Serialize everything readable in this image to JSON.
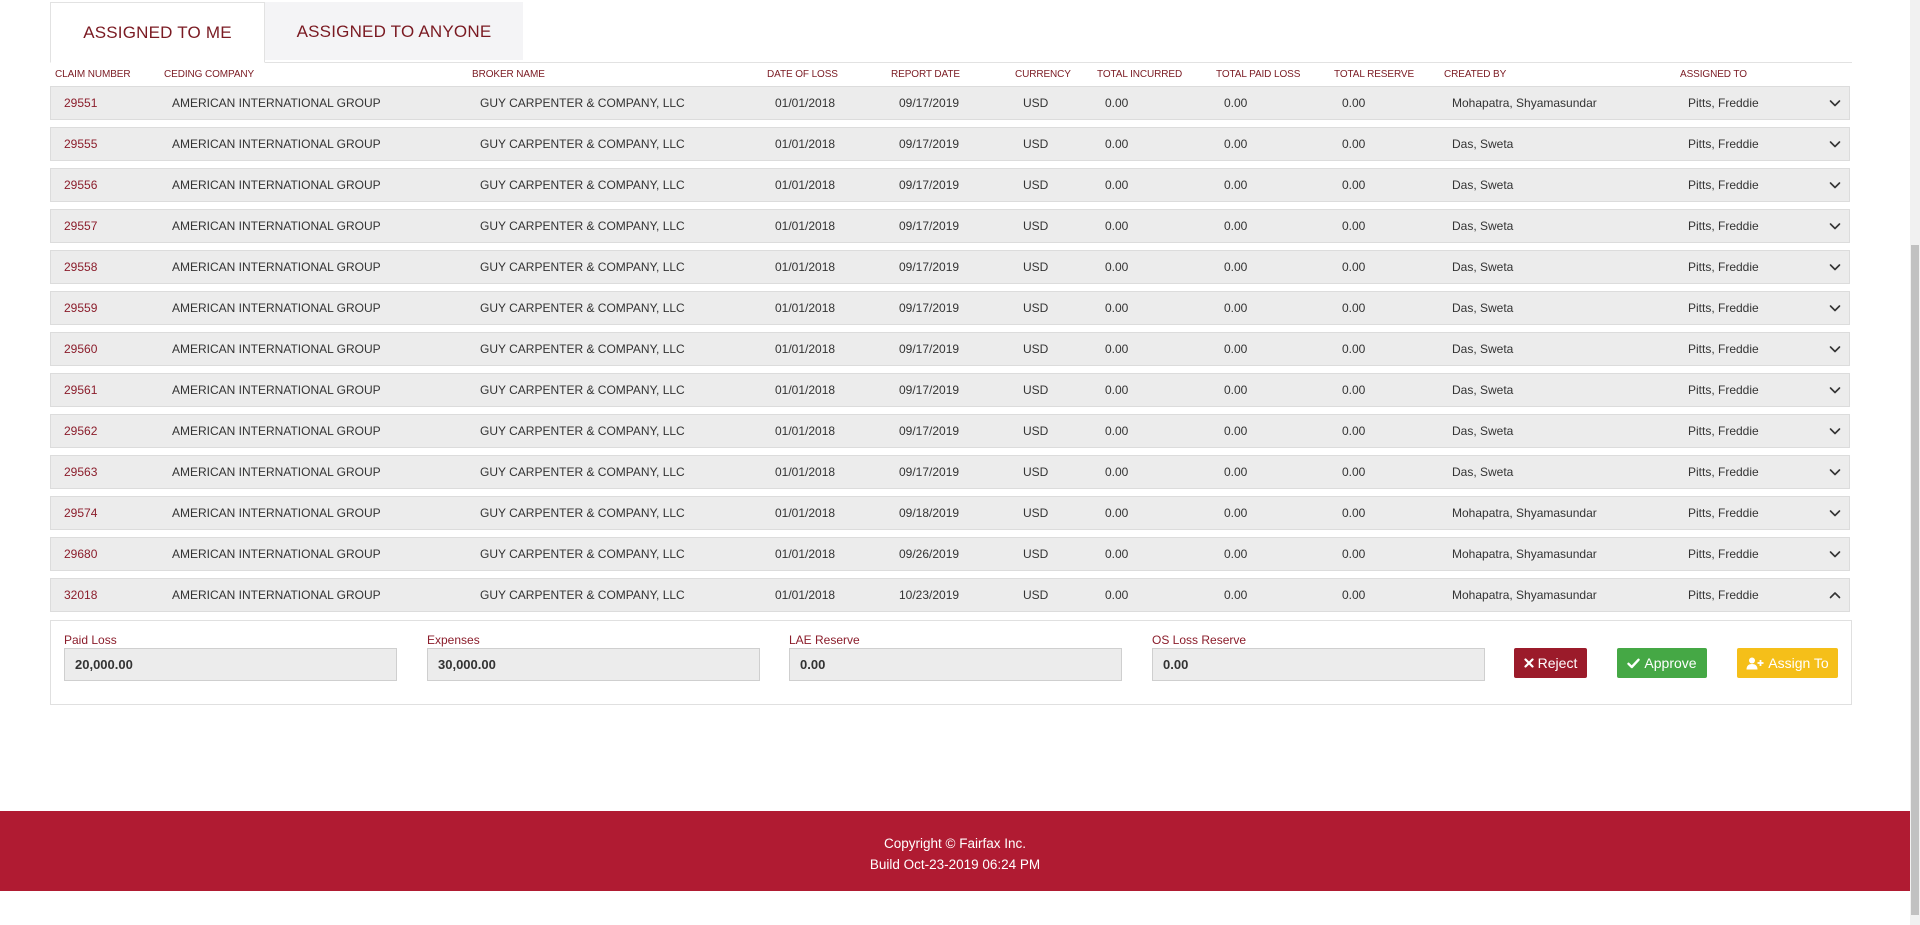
{
  "tabs": [
    {
      "label": "ASSIGNED TO ME",
      "active": true
    },
    {
      "label": "ASSIGNED TO ANYONE",
      "active": false
    }
  ],
  "columns": {
    "claim_number": "CLAIM NUMBER",
    "ceding_company": "CEDING COMPANY",
    "broker_name": "BROKER NAME",
    "date_of_loss": "DATE OF LOSS",
    "report_date": "REPORT DATE",
    "currency": "CURRENCY",
    "total_incurred": "TOTAL INCURRED",
    "total_paid_loss": "TOTAL PAID LOSS",
    "total_reserve": "TOTAL RESERVE",
    "created_by": "CREATED BY",
    "assigned_to": "ASSIGNED TO"
  },
  "rows": [
    {
      "claim": "29551",
      "ceding": "AMERICAN INTERNATIONAL GROUP",
      "broker": "GUY CARPENTER & COMPANY, LLC",
      "dol": "01/01/2018",
      "report": "09/17/2019",
      "currency": "USD",
      "incurred": "0.00",
      "paid": "0.00",
      "reserve": "0.00",
      "created_by": "Mohapatra, Shyamasundar",
      "assigned_to": "Pitts, Freddie",
      "expanded": false
    },
    {
      "claim": "29555",
      "ceding": "AMERICAN INTERNATIONAL GROUP",
      "broker": "GUY CARPENTER & COMPANY, LLC",
      "dol": "01/01/2018",
      "report": "09/17/2019",
      "currency": "USD",
      "incurred": "0.00",
      "paid": "0.00",
      "reserve": "0.00",
      "created_by": "Das, Sweta",
      "assigned_to": "Pitts, Freddie",
      "expanded": false
    },
    {
      "claim": "29556",
      "ceding": "AMERICAN INTERNATIONAL GROUP",
      "broker": "GUY CARPENTER & COMPANY, LLC",
      "dol": "01/01/2018",
      "report": "09/17/2019",
      "currency": "USD",
      "incurred": "0.00",
      "paid": "0.00",
      "reserve": "0.00",
      "created_by": "Das, Sweta",
      "assigned_to": "Pitts, Freddie",
      "expanded": false
    },
    {
      "claim": "29557",
      "ceding": "AMERICAN INTERNATIONAL GROUP",
      "broker": "GUY CARPENTER & COMPANY, LLC",
      "dol": "01/01/2018",
      "report": "09/17/2019",
      "currency": "USD",
      "incurred": "0.00",
      "paid": "0.00",
      "reserve": "0.00",
      "created_by": "Das, Sweta",
      "assigned_to": "Pitts, Freddie",
      "expanded": false
    },
    {
      "claim": "29558",
      "ceding": "AMERICAN INTERNATIONAL GROUP",
      "broker": "GUY CARPENTER & COMPANY, LLC",
      "dol": "01/01/2018",
      "report": "09/17/2019",
      "currency": "USD",
      "incurred": "0.00",
      "paid": "0.00",
      "reserve": "0.00",
      "created_by": "Das, Sweta",
      "assigned_to": "Pitts, Freddie",
      "expanded": false
    },
    {
      "claim": "29559",
      "ceding": "AMERICAN INTERNATIONAL GROUP",
      "broker": "GUY CARPENTER & COMPANY, LLC",
      "dol": "01/01/2018",
      "report": "09/17/2019",
      "currency": "USD",
      "incurred": "0.00",
      "paid": "0.00",
      "reserve": "0.00",
      "created_by": "Das, Sweta",
      "assigned_to": "Pitts, Freddie",
      "expanded": false
    },
    {
      "claim": "29560",
      "ceding": "AMERICAN INTERNATIONAL GROUP",
      "broker": "GUY CARPENTER & COMPANY, LLC",
      "dol": "01/01/2018",
      "report": "09/17/2019",
      "currency": "USD",
      "incurred": "0.00",
      "paid": "0.00",
      "reserve": "0.00",
      "created_by": "Das, Sweta",
      "assigned_to": "Pitts, Freddie",
      "expanded": false
    },
    {
      "claim": "29561",
      "ceding": "AMERICAN INTERNATIONAL GROUP",
      "broker": "GUY CARPENTER & COMPANY, LLC",
      "dol": "01/01/2018",
      "report": "09/17/2019",
      "currency": "USD",
      "incurred": "0.00",
      "paid": "0.00",
      "reserve": "0.00",
      "created_by": "Das, Sweta",
      "assigned_to": "Pitts, Freddie",
      "expanded": false
    },
    {
      "claim": "29562",
      "ceding": "AMERICAN INTERNATIONAL GROUP",
      "broker": "GUY CARPENTER & COMPANY, LLC",
      "dol": "01/01/2018",
      "report": "09/17/2019",
      "currency": "USD",
      "incurred": "0.00",
      "paid": "0.00",
      "reserve": "0.00",
      "created_by": "Das, Sweta",
      "assigned_to": "Pitts, Freddie",
      "expanded": false
    },
    {
      "claim": "29563",
      "ceding": "AMERICAN INTERNATIONAL GROUP",
      "broker": "GUY CARPENTER & COMPANY, LLC",
      "dol": "01/01/2018",
      "report": "09/17/2019",
      "currency": "USD",
      "incurred": "0.00",
      "paid": "0.00",
      "reserve": "0.00",
      "created_by": "Das, Sweta",
      "assigned_to": "Pitts, Freddie",
      "expanded": false
    },
    {
      "claim": "29574",
      "ceding": "AMERICAN INTERNATIONAL GROUP",
      "broker": "GUY CARPENTER & COMPANY, LLC",
      "dol": "01/01/2018",
      "report": "09/18/2019",
      "currency": "USD",
      "incurred": "0.00",
      "paid": "0.00",
      "reserve": "0.00",
      "created_by": "Mohapatra, Shyamasundar",
      "assigned_to": "Pitts, Freddie",
      "expanded": false
    },
    {
      "claim": "29680",
      "ceding": "AMERICAN INTERNATIONAL GROUP",
      "broker": "GUY CARPENTER & COMPANY, LLC",
      "dol": "01/01/2018",
      "report": "09/26/2019",
      "currency": "USD",
      "incurred": "0.00",
      "paid": "0.00",
      "reserve": "0.00",
      "created_by": "Mohapatra, Shyamasundar",
      "assigned_to": "Pitts, Freddie",
      "expanded": false
    },
    {
      "claim": "32018",
      "ceding": "AMERICAN INTERNATIONAL GROUP",
      "broker": "GUY CARPENTER & COMPANY, LLC",
      "dol": "01/01/2018",
      "report": "10/23/2019",
      "currency": "USD",
      "incurred": "0.00",
      "paid": "0.00",
      "reserve": "0.00",
      "created_by": "Mohapatra, Shyamasundar",
      "assigned_to": "Pitts, Freddie",
      "expanded": true
    }
  ],
  "detail": {
    "paid_loss_label": "Paid Loss",
    "paid_loss_value": "20,000.00",
    "expenses_label": "Expenses",
    "expenses_value": "30,000.00",
    "lae_reserve_label": "LAE Reserve",
    "lae_reserve_value": "0.00",
    "os_loss_reserve_label": "OS Loss Reserve",
    "os_loss_reserve_value": "0.00",
    "reject_label": "Reject",
    "approve_label": "Approve",
    "assign_label": "Assign To"
  },
  "footer": {
    "copyright": "Copyright © Fairfax Inc.",
    "build": "Build Oct-23-2019 06:24 PM"
  },
  "colors": {
    "brand": "#b01b32",
    "reject": "#9b1b2a",
    "approve": "#45a845",
    "assign": "#f5bf19",
    "link": "#8b1d2b"
  }
}
